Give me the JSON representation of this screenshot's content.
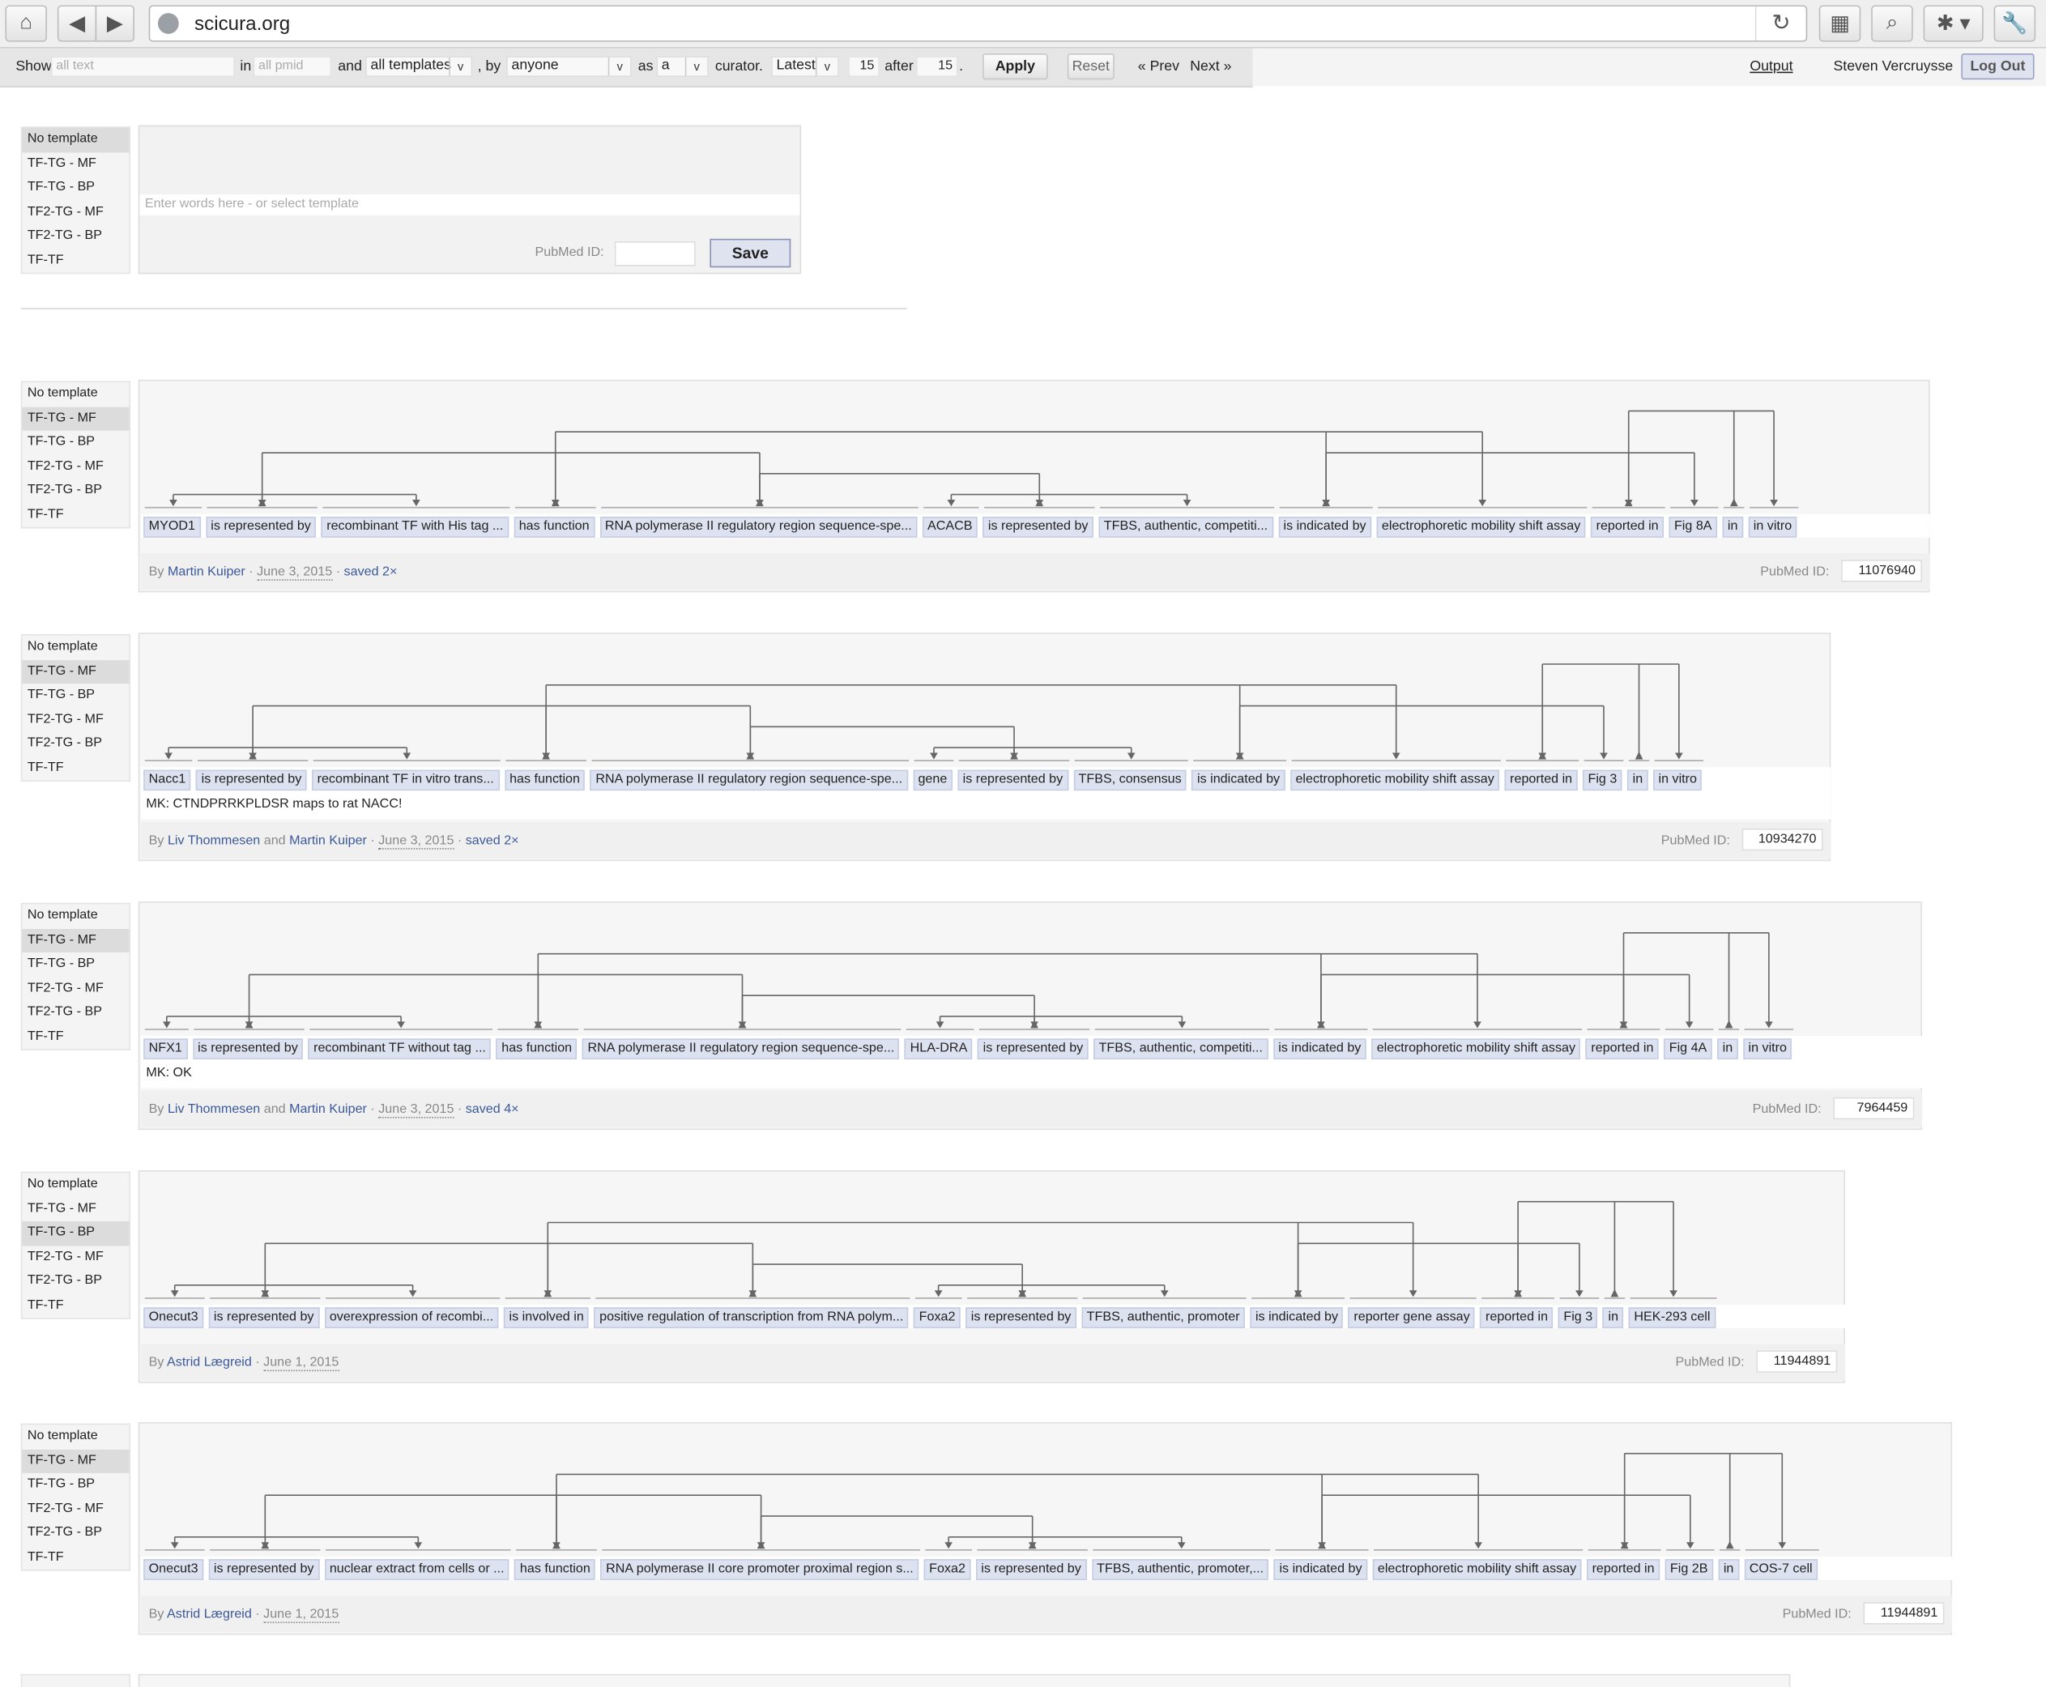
{
  "browser": {
    "url": "scicura.org",
    "buttons": [
      "home-icon",
      "back-icon",
      "forward-icon",
      "reload-icon",
      "tabs-icon",
      "search-page-icon",
      "extensions-icon",
      "settings-icon"
    ]
  },
  "toolbar": {
    "show_label": "Show",
    "text_placeholder": "all text",
    "in_label": "in",
    "pmid_placeholder": "all pmid",
    "and_label": "and",
    "templates_select": "all templates",
    "by_label": ", by",
    "user_select": "anyone",
    "as_label": "as",
    "role_select": "a",
    "curator_label": "curator.",
    "sort_select": "Latest",
    "count": "15",
    "after_label": "after",
    "offset": "15",
    "period": ".",
    "apply": "Apply",
    "reset": "Reset",
    "prev": "« Prev",
    "next": "Next »",
    "output": "Output",
    "user_name": "Steven Vercruysse",
    "logout": "Log Out"
  },
  "template_options": [
    "No template",
    "TF-TG - MF",
    "TF-TG - BP",
    "TF2-TG - MF",
    "TF2-TG - BP",
    "TF-TF"
  ],
  "composer": {
    "selected_template": 0,
    "placeholder": "Enter words here  -  or select template",
    "pubmed_label": "PubMed ID:",
    "save": "Save"
  },
  "annotations": [
    {
      "selected_template": 1,
      "chips": [
        "MYOD1",
        "is represented by",
        "recombinant TF with His tag ...",
        "has function",
        "RNA polymerase II regulatory region sequence-spe...",
        "ACACB",
        "is represented by",
        "TFBS, authentic, competiti...",
        "is indicated by",
        "electrophoretic mobility shift assay",
        "reported in",
        "Fig 8A",
        "in",
        "in vitro"
      ],
      "comment": "",
      "authors": [
        "Martin Kuiper"
      ],
      "date": "June 3, 2015",
      "saved": "saved 2×",
      "pubmed_label": "PubMed ID:",
      "pubmed": "11076940"
    },
    {
      "selected_template": 1,
      "chips": [
        "Nacc1",
        "is represented by",
        "recombinant TF in vitro trans...",
        "has function",
        "RNA polymerase II regulatory region sequence-spe...",
        "gene",
        "is represented by",
        "TFBS, consensus",
        "is indicated by",
        "electrophoretic mobility shift assay",
        "reported in",
        "Fig 3",
        "in",
        "in vitro"
      ],
      "comment": "MK: CTNDPRRKPLDSR maps to rat NACC!",
      "authors": [
        "Liv Thommesen",
        "Martin Kuiper"
      ],
      "date": "June 3, 2015",
      "saved": "saved 2×",
      "pubmed_label": "PubMed ID:",
      "pubmed": "10934270"
    },
    {
      "selected_template": 1,
      "chips": [
        "NFX1",
        "is represented by",
        "recombinant TF without tag ...",
        "has function",
        "RNA polymerase II regulatory region sequence-spe...",
        "HLA-DRA",
        "is represented by",
        "TFBS, authentic, competiti...",
        "is indicated by",
        "electrophoretic mobility shift assay",
        "reported in",
        "Fig 4A",
        "in",
        "in vitro"
      ],
      "comment": "MK: OK",
      "authors": [
        "Liv Thommesen",
        "Martin Kuiper"
      ],
      "date": "June 3, 2015",
      "saved": "saved 4×",
      "pubmed_label": "PubMed ID:",
      "pubmed": "7964459"
    },
    {
      "selected_template": 2,
      "chips": [
        "Onecut3",
        "is represented by",
        "overexpression of recombi...",
        "is involved in",
        "positive regulation of transcription from RNA polym...",
        "Foxa2",
        "is represented by",
        "TFBS, authentic, promoter",
        "is indicated by",
        "reporter gene assay",
        "reported in",
        "Fig 3",
        "in",
        "HEK-293 cell"
      ],
      "comment": "",
      "authors": [
        "Astrid Lægreid"
      ],
      "date": "June 1, 2015",
      "saved": "",
      "pubmed_label": "PubMed ID:",
      "pubmed": "11944891"
    },
    {
      "selected_template": 1,
      "chips": [
        "Onecut3",
        "is represented by",
        "nuclear extract from cells or ...",
        "has function",
        "RNA polymerase II core promoter proximal region s...",
        "Foxa2",
        "is represented by",
        "TFBS, authentic, promoter,...",
        "is indicated by",
        "electrophoretic mobility shift assay",
        "reported in",
        "Fig 2B",
        "in",
        "COS-7 cell"
      ],
      "comment": "",
      "authors": [
        "Astrid Lægreid"
      ],
      "date": "June 1, 2015",
      "saved": "",
      "pubmed_label": "PubMed ID:",
      "pubmed": "11944891"
    }
  ],
  "text": {
    "by": "By",
    "and": "and",
    "dot": "·"
  }
}
